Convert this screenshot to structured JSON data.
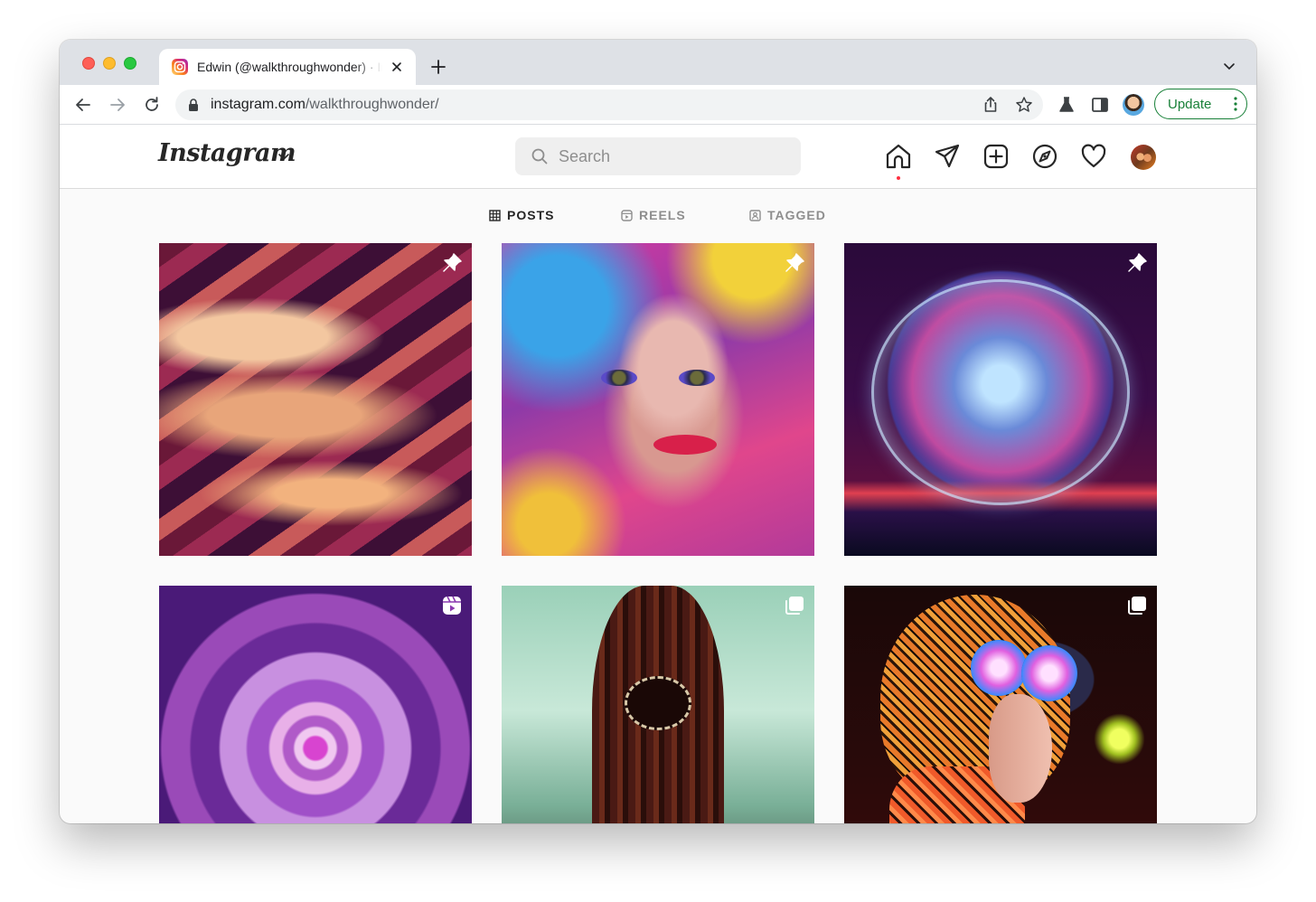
{
  "browser": {
    "tab_title": "Edwin (@walkthroughwonder) · Instagram",
    "url_domain": "instagram.com",
    "url_path": "/walkthroughwonder/",
    "update_label": "Update",
    "update_color": "#188038"
  },
  "instagram": {
    "logo": "Instagram",
    "search_placeholder": "Search",
    "nav_icons": [
      "home-icon",
      "direct-message-icon",
      "new-post-icon",
      "explore-icon",
      "activity-heart-icon",
      "profile-avatar"
    ],
    "notification_color": "#ff3040",
    "tabs": [
      {
        "label": "POSTS",
        "active": true
      },
      {
        "label": "REELS",
        "active": false
      },
      {
        "label": "TAGGED",
        "active": false
      }
    ],
    "posts": [
      {
        "subject": "abstract wavy layers",
        "badge": "pin-icon"
      },
      {
        "subject": "painted face portrait",
        "badge": "pin-icon"
      },
      {
        "subject": "city inside glass sphere",
        "badge": "pin-icon"
      },
      {
        "subject": "purple concentric pattern",
        "badge": "reel-icon"
      },
      {
        "subject": "horned creature",
        "badge": "multiple-images-icon"
      },
      {
        "subject": "woman with VR goggles",
        "badge": "multiple-images-icon"
      }
    ]
  }
}
